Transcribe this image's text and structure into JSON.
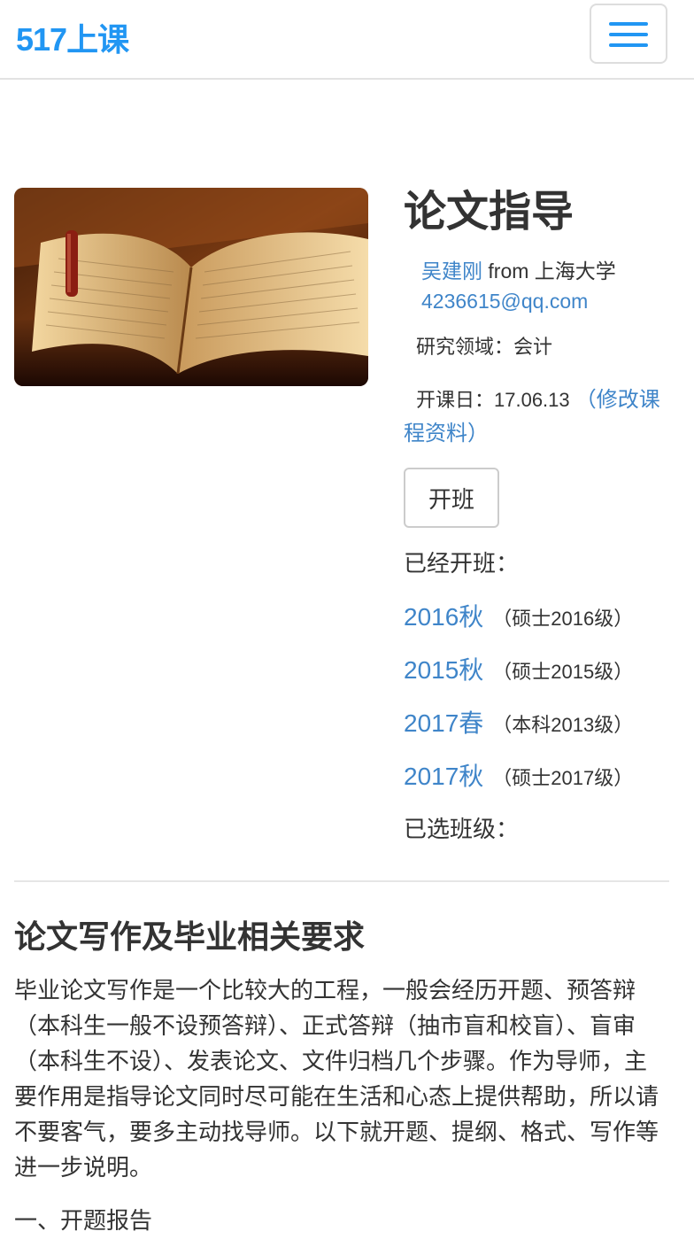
{
  "nav": {
    "brand": "517上课"
  },
  "course": {
    "title": "论文指导",
    "teacher_name": "吴建刚",
    "from_text": " from 上海大学",
    "email": "4236615@qq.com",
    "field": "研究领域：会计",
    "start_date": "开课日：17.06.13",
    "edit_link": "（修改课程资料）",
    "open_button": "开班",
    "opened_label": "已经开班：",
    "classes": [
      {
        "name": "2016秋",
        "note": "（硕士2016级）"
      },
      {
        "name": "2015秋",
        "note": "（硕士2015级）"
      },
      {
        "name": "2017春",
        "note": "（本科2013级）"
      },
      {
        "name": "2017秋",
        "note": "（硕士2017级）"
      }
    ],
    "selected_label": "已选班级："
  },
  "section": {
    "title": "论文写作及毕业相关要求",
    "body": "毕业论文写作是一个比较大的工程，一般会经历开题、预答辩（本科生一般不设预答辩）、正式答辩（抽市盲和校盲）、盲审（本科生不设）、发表论文、文件归档几个步骤。作为导师，主要作用是指导论文同时尽可能在生活和心态上提供帮助，所以请不要客气，要多主动找导师。以下就开题、提纲、格式、写作等进一步说明。",
    "subheading": "一、开题报告"
  }
}
